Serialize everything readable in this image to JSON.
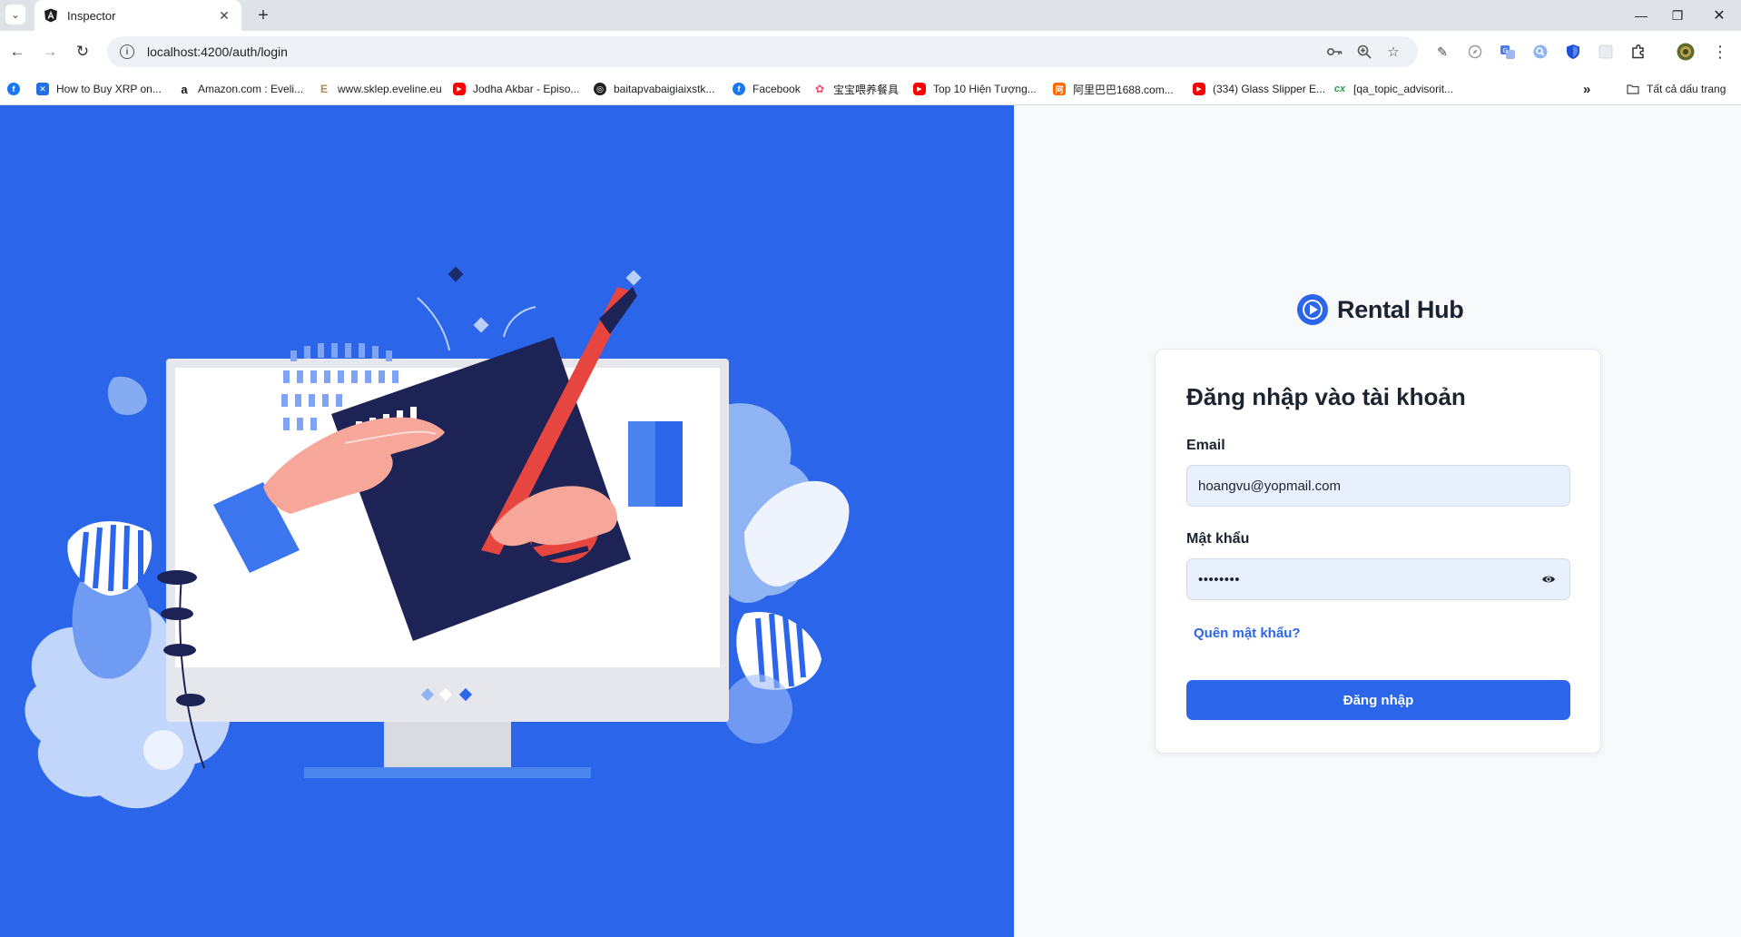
{
  "browser": {
    "tab_title": "Inspector",
    "url": "localhost:4200/auth/login",
    "new_tab_symbol": "+",
    "bookmarks": [
      {
        "label": "How to Buy XRP on...",
        "icon": "xrp-icon",
        "color": "#1f6fe5"
      },
      {
        "label": "Amazon.com : Eveli...",
        "icon": "amazon-icon",
        "color": "#111111"
      },
      {
        "label": "www.sklep.eveline.eu",
        "icon": "eveline-icon",
        "color": "#b08a5a"
      },
      {
        "label": "Jodha Akbar - Episo...",
        "icon": "youtube-icon",
        "color": "#ff0000"
      },
      {
        "label": "baitapvabaigiaixstk...",
        "icon": "globe-icon",
        "color": "#222222"
      },
      {
        "label": "Facebook",
        "icon": "facebook-icon",
        "color": "#1877f2"
      },
      {
        "label": "宝宝喂养餐具",
        "icon": "taobao-icon",
        "color": "#ff4a6b"
      },
      {
        "label": "Top 10 Hiện Tượng...",
        "icon": "youtube-icon",
        "color": "#ff0000"
      },
      {
        "label": "阿里巴巴1688.com...",
        "icon": "alibaba-icon",
        "color": "#ff6a00"
      },
      {
        "label": "(334) Glass Slipper E...",
        "icon": "youtube-icon",
        "color": "#ff0000"
      },
      {
        "label": "[qa_topic_advisorit...",
        "icon": "qa-icon",
        "color": "#2e9e4f"
      }
    ],
    "bookmarks_overflow": "»",
    "all_bookmarks_label": "Tất cả dấu trang"
  },
  "brand": {
    "name": "Rental Hub",
    "accent_color": "#2a65ea"
  },
  "login": {
    "title": "Đăng nhập vào tài khoản",
    "email_label": "Email",
    "email_value": "hoangvu@yopmail.com",
    "password_label": "Mật khẩu",
    "password_value": "••••••••",
    "forgot_label": "Quên mật khẩu?",
    "submit_label": "Đăng nhập"
  }
}
